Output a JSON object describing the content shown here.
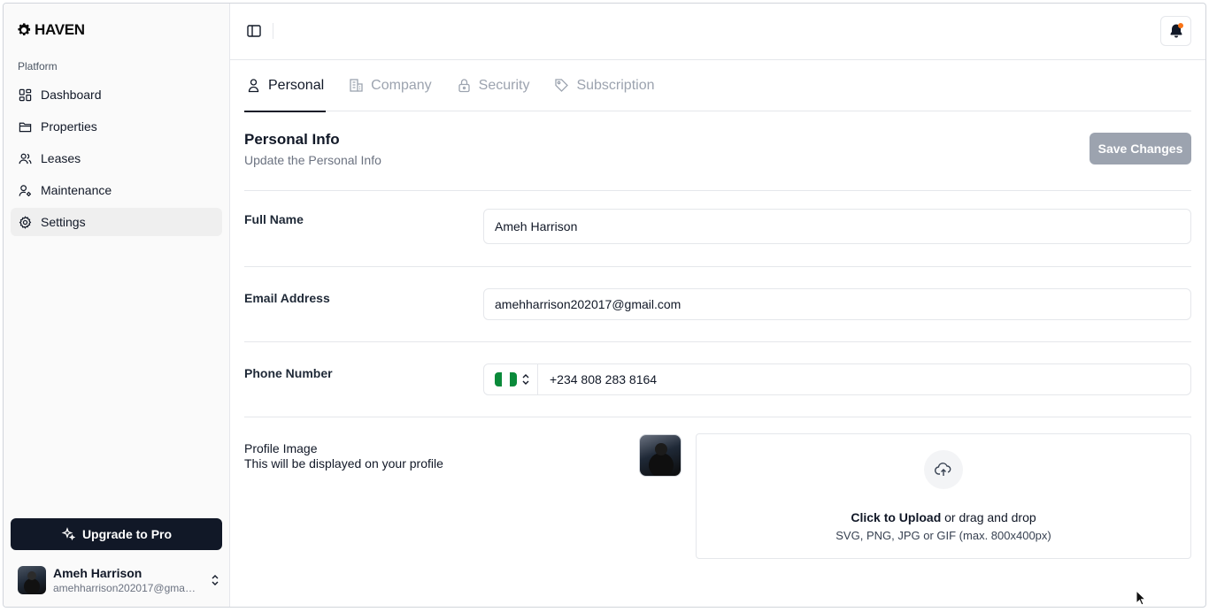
{
  "app": {
    "name": "HAVEN"
  },
  "sidebar": {
    "section_label": "Platform",
    "items": [
      {
        "label": "Dashboard",
        "icon": "dashboard-icon"
      },
      {
        "label": "Properties",
        "icon": "folder-icon"
      },
      {
        "label": "Leases",
        "icon": "users-icon"
      },
      {
        "label": "Maintenance",
        "icon": "user-gear-icon"
      },
      {
        "label": "Settings",
        "icon": "gear-icon",
        "active": true
      }
    ],
    "upgrade_label": "Upgrade to Pro",
    "user": {
      "name": "Ameh Harrison",
      "email": "amehharrison202017@gmail.c..."
    }
  },
  "tabs": [
    {
      "label": "Personal",
      "active": true
    },
    {
      "label": "Company"
    },
    {
      "label": "Security"
    },
    {
      "label": "Subscription"
    }
  ],
  "section": {
    "title": "Personal Info",
    "subtitle": "Update the Personal Info",
    "save_label": "Save Changes"
  },
  "form": {
    "full_name": {
      "label": "Full Name",
      "value": "Ameh Harrison"
    },
    "email": {
      "label": "Email Address",
      "value": "amehharrison202017@gmail.com"
    },
    "phone": {
      "label": "Phone Number",
      "value": "+234 808 283 8164",
      "country_flag": "nigeria-flag"
    },
    "profile_image": {
      "label": "Profile Image",
      "sublabel": "This will be displayed on your profile",
      "upload_action": "Click to Upload",
      "upload_rest": " or drag and drop",
      "upload_hint": "SVG, PNG, JPG or GIF (max. 800x400px)"
    }
  },
  "colors": {
    "primary": "#111827",
    "save_disabled": "#9ca3af",
    "flag_green": "#0a8a3a",
    "notification_dot": "#f97316"
  }
}
